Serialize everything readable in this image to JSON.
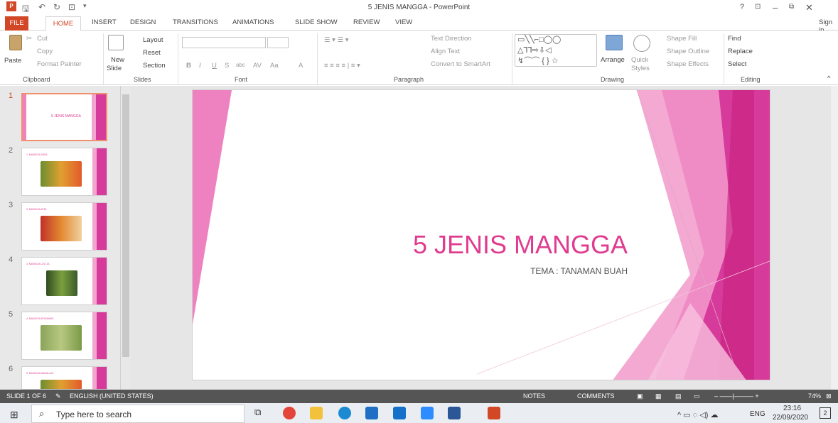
{
  "window": {
    "title": "5 JENIS MANGGA - PowerPoint",
    "help": "?",
    "signin": "Sign in"
  },
  "tabs": [
    "FILE",
    "HOME",
    "INSERT",
    "DESIGN",
    "TRANSITIONS",
    "ANIMATIONS",
    "SLIDE SHOW",
    "REVIEW",
    "VIEW"
  ],
  "ribbon": {
    "clipboard": {
      "label": "Clipboard",
      "paste": "Paste",
      "cut": "Cut",
      "copy": "Copy",
      "painter": "Format Painter"
    },
    "slides": {
      "label": "Slides",
      "new_slide": "New",
      "new_slide2": "Slide",
      "layout": "Layout",
      "reset": "Reset",
      "section": "Section"
    },
    "font": {
      "label": "Font",
      "bold": "B",
      "italic": "I",
      "underline": "U",
      "shadow": "S",
      "strike": "abc",
      "spacing": "AV",
      "case": "Aa",
      "color": "A"
    },
    "paragraph": {
      "label": "Paragraph",
      "text_direction": "Text Direction",
      "align_text": "Align Text",
      "smartart": "Convert to SmartArt"
    },
    "drawing": {
      "label": "Drawing",
      "arrange": "Arrange",
      "quick": "Quick",
      "styles": "Styles",
      "fill": "Shape Fill",
      "outline": "Shape Outline",
      "effects": "Shape Effects"
    },
    "editing": {
      "label": "Editing",
      "find": "Find",
      "replace": "Replace",
      "select": "Select"
    }
  },
  "thumbnails": [
    {
      "num": "1",
      "title": "5 JENIS MANGGA"
    },
    {
      "num": "2",
      "title": "1. MANGGA INDIA"
    },
    {
      "num": "3",
      "title": "2. MANGGA APEL"
    },
    {
      "num": "4",
      "title": "3. MANGGA LUO JA"
    },
    {
      "num": "5",
      "title": "4. MANGGA ARUMANIS"
    },
    {
      "num": "6",
      "title": "5. MANGGA MANALAGI"
    }
  ],
  "slide": {
    "title": "5 JENIS MANGGA",
    "subtitle": "TEMA : TANAMAN BUAH"
  },
  "status": {
    "slide": "SLIDE 1 OF 6",
    "lang": "ENGLISH (UNITED STATES)",
    "notes": "NOTES",
    "comments": "COMMENTS",
    "zoom": "74%"
  },
  "taskbar": {
    "search_placeholder": "Type here to search",
    "lang": "ENG",
    "time": "23:16",
    "date": "22/09/2020",
    "notif": "2"
  },
  "colors": {
    "accent": "#d24726",
    "pink": "#e03c8f",
    "magenta": "#c71f80"
  }
}
